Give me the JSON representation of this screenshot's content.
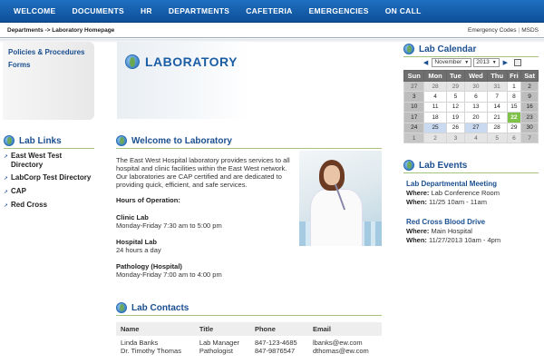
{
  "nav": {
    "items": [
      "WELCOME",
      "DOCUMENTS",
      "HR",
      "DEPARTMENTS",
      "CAFETERIA",
      "EMERGENCIES",
      "ON CALL"
    ]
  },
  "subbar": {
    "breadcrumb": "Departments -> Laboratory Homepage",
    "emergency_codes": "Emergency Codes",
    "separator": "|",
    "msds": "MSDS"
  },
  "quicklinks": {
    "policies": "Policies & Procedures",
    "forms": "Forms"
  },
  "lab_links": {
    "title": "Lab Links",
    "items": [
      "East West Test Directory",
      "LabCorp Test Directory",
      "CAP",
      "Red Cross"
    ]
  },
  "banner": {
    "title": "LABORATORY"
  },
  "welcome": {
    "title": "Welcome to Laboratory",
    "intro": "The East West Hospital laboratory provides services to all hospital and clinic facilities within the East West network. Our laboratories are CAP certified and are dedicated to providing quick, efficient, and safe services.",
    "hours_heading": "Hours of Operation:",
    "hours": [
      {
        "name": "Clinic Lab",
        "time": "Monday-Friday 7:30 am to 5:00 pm"
      },
      {
        "name": "Hospital Lab",
        "time": "24 hours a day"
      },
      {
        "name": "Pathology (Hospital)",
        "time": "Monday-Friday 7:00 am to 4:00 pm"
      }
    ]
  },
  "contacts": {
    "title": "Lab Contacts",
    "headers": [
      "Name",
      "Title",
      "Phone",
      "Email"
    ],
    "rows": [
      [
        "Linda Banks",
        "Lab Manager",
        "847-123-4685",
        "lbanks@ew.com"
      ],
      [
        "Dr. Timothy Thomas",
        "Pathologist",
        "847-9876547",
        "dthomas@ew.com"
      ]
    ]
  },
  "calendar": {
    "title": "Lab Calendar",
    "month": "November",
    "year": "2013",
    "prev_arrow": "◀",
    "next_arrow": "▶",
    "weekdays": [
      "Sun",
      "Mon",
      "Tue",
      "Wed",
      "Thu",
      "Fri",
      "Sat"
    ],
    "weeks": [
      [
        "27",
        "28",
        "29",
        "30",
        "31",
        "1",
        "2"
      ],
      [
        "3",
        "4",
        "5",
        "6",
        "7",
        "8",
        "9"
      ],
      [
        "10",
        "11",
        "12",
        "13",
        "14",
        "15",
        "16"
      ],
      [
        "17",
        "18",
        "19",
        "20",
        "21",
        "22",
        "23"
      ],
      [
        "24",
        "25",
        "26",
        "27",
        "28",
        "29",
        "30"
      ],
      [
        "1",
        "2",
        "3",
        "4",
        "5",
        "6",
        "7"
      ]
    ],
    "today": "22",
    "event_days": [
      "25",
      "27"
    ]
  },
  "events": {
    "title": "Lab Events",
    "where_label": "Where:",
    "when_label": "When:",
    "items": [
      {
        "name": "Lab Departmental Meeting",
        "where": "Lab Conference Room",
        "when": "11/25 10am - 11am"
      },
      {
        "name": "Red Cross Blood Drive",
        "where": "Main Hospital",
        "when": "11/27/2013 10am - 4pm"
      }
    ]
  },
  "colors": {
    "nav_blue": "#0d4f99",
    "link_blue": "#1b4f91",
    "section_rule": "#a8c47a",
    "today_green": "#7fc24a"
  }
}
